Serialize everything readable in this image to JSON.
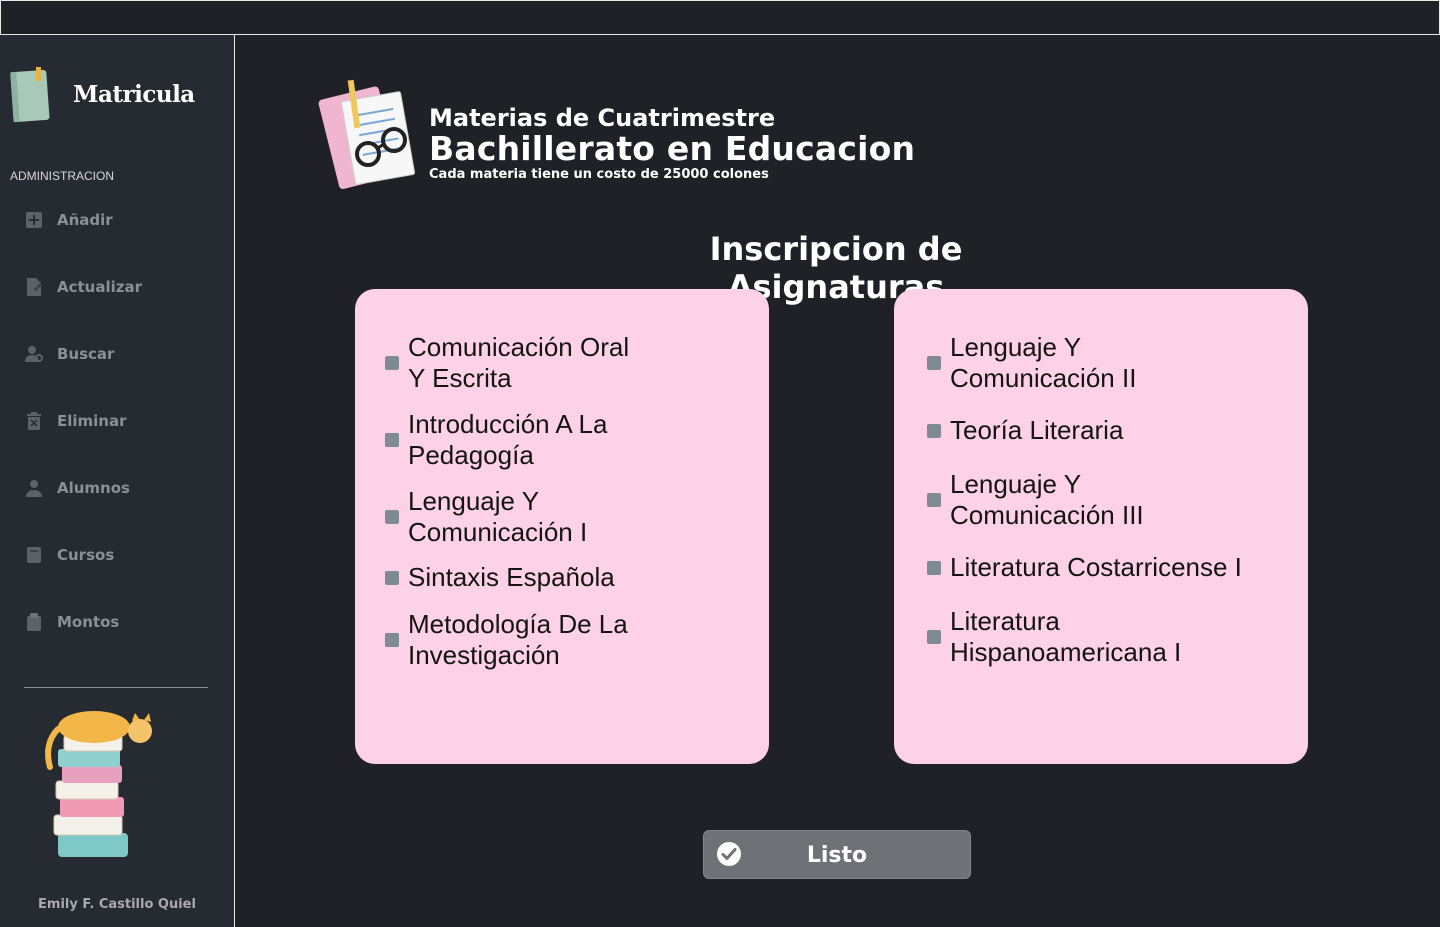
{
  "app": {
    "logo_title": "Matricula",
    "section_label": "ADMINISTRACION",
    "author": "Emily F. Castillo Quiel"
  },
  "sidebar": {
    "items": [
      {
        "label": "Añadir",
        "icon": "add-icon"
      },
      {
        "label": "Actualizar",
        "icon": "edit-file-icon"
      },
      {
        "label": "Buscar",
        "icon": "search-user-icon"
      },
      {
        "label": "Eliminar",
        "icon": "trash-icon"
      },
      {
        "label": "Alumnos",
        "icon": "user-icon"
      },
      {
        "label": "Cursos",
        "icon": "book-icon"
      },
      {
        "label": "Montos",
        "icon": "clipboard-icon"
      }
    ]
  },
  "header": {
    "subtitle": "Materias de Cuatrimestre",
    "program": "Bachillerato en Educacion",
    "note": "Cada materia tiene un costo de 25000 colones"
  },
  "main": {
    "title": "Inscripcion de Asignaturas",
    "left_subjects": [
      "Comunicación Oral\nY Escrita",
      "Introducción A La\nPedagogía",
      "Lenguaje Y\nComunicación I",
      "Sintaxis Española",
      "Metodología De La\nInvestigación"
    ],
    "right_subjects": [
      "Lenguaje Y\nComunicación II",
      "Teoría Literaria",
      "Lenguaje Y\nComunicación III",
      "Literatura Costarricense I",
      "Literatura\nHispanoamericana I"
    ],
    "done_label": "Listo"
  },
  "colors": {
    "background": "#1f2126",
    "sidebar": "#262a31",
    "card": "#fed2e6",
    "button": "#6f7177"
  }
}
